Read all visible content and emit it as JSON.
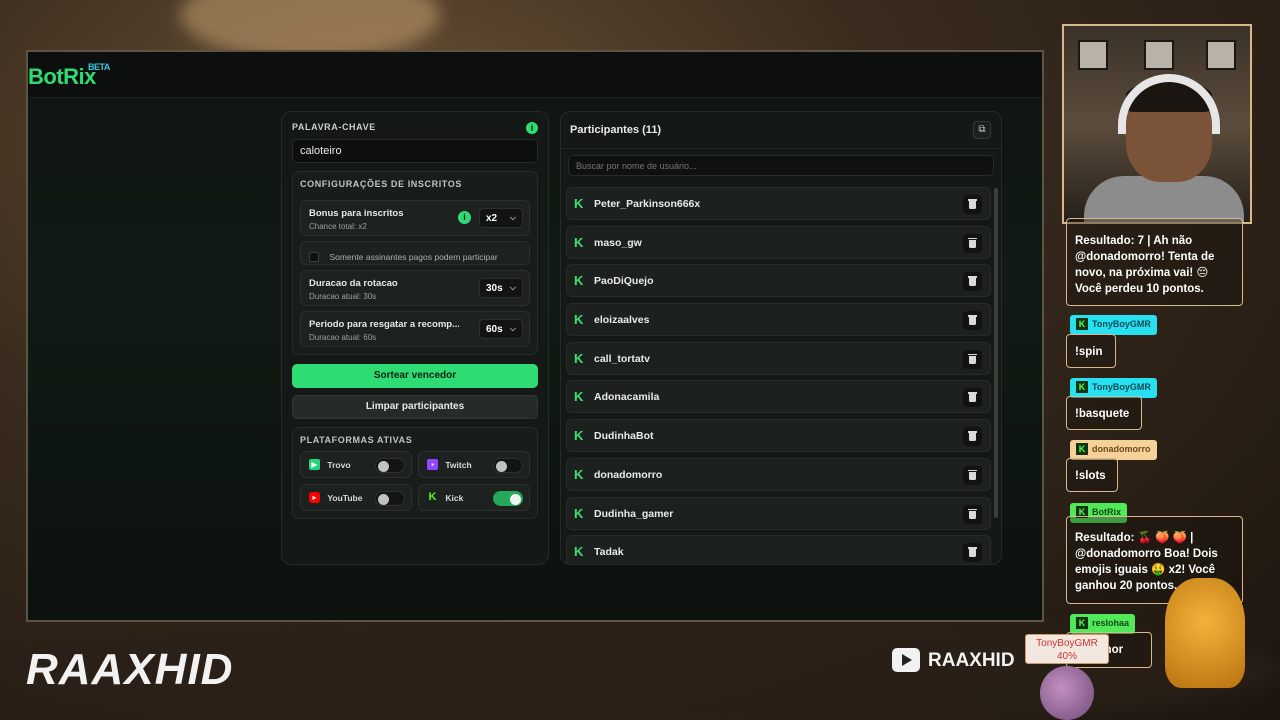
{
  "app": {
    "logo": "BotRix",
    "logo_badge": "BETA"
  },
  "left": {
    "keyword_label": "PALAVRA-CHAVE",
    "keyword_value": "caloteiro",
    "subs_title": "CONFIGURAÇÕES DE INSCRITOS",
    "bonus_title": "Bonus para inscritos",
    "bonus_sub": "Chance total: x2",
    "bonus_value": "x2",
    "paid_only": "Somente assinantes pagos podem participar",
    "rotation_title": "Duracao da rotacao",
    "rotation_sub": "Duracao atual: 30s",
    "rotation_value": "30s",
    "claim_title": "Periodo para resgatar a recomp...",
    "claim_sub": "Duracao atual: 60s",
    "claim_value": "60s",
    "draw_button": "Sortear vencedor",
    "clear_button": "Limpar participantes",
    "platforms_title": "PLATAFORMAS ATIVAS",
    "platforms": [
      {
        "name": "Trovo",
        "enabled": false,
        "color": "#1fd47a"
      },
      {
        "name": "Twitch",
        "enabled": false,
        "color": "#9146ff"
      },
      {
        "name": "YouTube",
        "enabled": false,
        "color": "#ff0000"
      },
      {
        "name": "Kick",
        "enabled": true,
        "color": "#53fc18"
      }
    ]
  },
  "right": {
    "title": "Participantes (11)",
    "search_placeholder": "Buscar por nome de usuário...",
    "participants": [
      "Peter_Parkinson666x",
      "maso_gw",
      "PaoDiQuejo",
      "eloizaalves",
      "call_tortatv",
      "Adonacamila",
      "DudinhaBot",
      "donadomorro",
      "Dudinha_gamer",
      "Tadak"
    ]
  },
  "overlay": {
    "chat": [
      {
        "user": "",
        "text": "Resultado: 7 | Ah não @donadomorro! Tenta de novo, na próxima vai! 😔 Você perdeu 10 pontos."
      },
      {
        "user": "TonyBoyGMR",
        "text": "!spin"
      },
      {
        "user": "TonyBoyGMR",
        "text": "!basquete"
      },
      {
        "user": "donadomorro",
        "text": "!slots"
      },
      {
        "user": "BotRix",
        "text": "Resultado: 🍒 🍑 🍑 | @donadomorro Boa! Dois emojis iguais 🤑 x2! Você ganhou 20 pontos."
      },
      {
        "user": "reslohaa",
        "text": "amor"
      }
    ],
    "brand": "RAAXHID",
    "yt_channel": "RAAXHID",
    "rank_name": "TonyBoyGMR",
    "rank_pct": "40%"
  },
  "colors": {
    "accent": "#2fdc74",
    "kick": "#53fc18"
  }
}
